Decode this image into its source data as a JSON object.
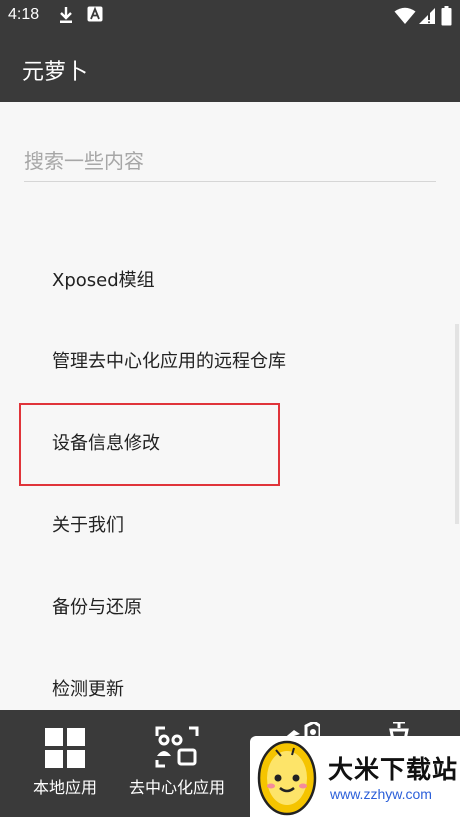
{
  "status_bar": {
    "time": "4:18",
    "icons": [
      "download-icon",
      "a-notification-icon",
      "wifi-icon",
      "signal-icon",
      "battery-icon"
    ]
  },
  "app_bar": {
    "title": "元萝卜"
  },
  "search": {
    "placeholder": "搜索一些内容"
  },
  "menu": {
    "items": [
      {
        "label": "Xposed模组"
      },
      {
        "label": "管理去中心化应用的远程仓库"
      },
      {
        "label": "设备信息修改"
      },
      {
        "label": "关于我们"
      },
      {
        "label": "备份与还原"
      },
      {
        "label": "检测更新"
      }
    ]
  },
  "bottom_nav": {
    "items": [
      {
        "label": "本地应用",
        "icon": "grid-icon"
      },
      {
        "label": "去中心化应用",
        "icon": "apps-network-icon"
      },
      {
        "label": "",
        "icon": "settings-icon"
      },
      {
        "label": "",
        "icon": "bug-icon"
      }
    ]
  },
  "watermark": {
    "title": "大米下载站",
    "url": "www.zzhyw.com"
  },
  "colors": {
    "bar": "#3a3a3a",
    "background": "#f7f7f7",
    "highlight_border": "#e0343a"
  }
}
